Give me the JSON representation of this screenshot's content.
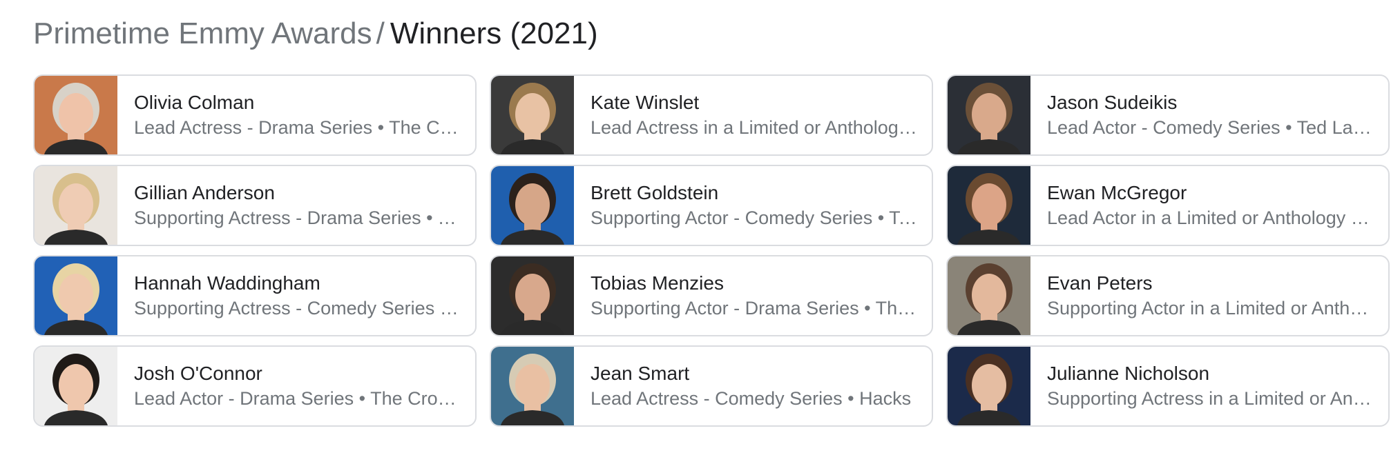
{
  "breadcrumb": {
    "parent": "Primetime Emmy Awards",
    "separator": "/",
    "current": "Winners (2021)"
  },
  "winners": [
    {
      "name": "Olivia Colman",
      "description": "Lead Actress - Drama Series • The Crown",
      "photo_bg": "#c9794a",
      "hair": "#d8d2c8",
      "skin": "#efc3a9"
    },
    {
      "name": "Kate Winslet",
      "description": "Lead Actress in a Limited or Anthology Series or Movie • Mare of Easttown",
      "photo_bg": "#3a3a3a",
      "hair": "#9b7a4e",
      "skin": "#e8c2a4"
    },
    {
      "name": "Jason Sudeikis",
      "description": "Lead Actor - Comedy Series • Ted Lasso",
      "photo_bg": "#2b2f36",
      "hair": "#6b5038",
      "skin": "#d9a98b"
    },
    {
      "name": "Gillian Anderson",
      "description": "Supporting Actress - Drama Series • The Crown",
      "photo_bg": "#e9e4de",
      "hair": "#d8bf8c",
      "skin": "#efccb4"
    },
    {
      "name": "Brett Goldstein",
      "description": "Supporting Actor - Comedy Series • Ted Lasso",
      "photo_bg": "#1f5fae",
      "hair": "#2b211b",
      "skin": "#d6a688"
    },
    {
      "name": "Ewan McGregor",
      "description": "Lead Actor in a Limited or Anthology Series or Movie • Halston",
      "photo_bg": "#1e2a3a",
      "hair": "#6a4a30",
      "skin": "#dca487"
    },
    {
      "name": "Hannah Waddingham",
      "description": "Supporting Actress - Comedy Series • Ted Lasso",
      "photo_bg": "#2161b6",
      "hair": "#e7d4a4",
      "skin": "#efc9ae"
    },
    {
      "name": "Tobias Menzies",
      "description": "Supporting Actor - Drama Series • The Crown",
      "photo_bg": "#2c2c2c",
      "hair": "#3b2c22",
      "skin": "#d8a88c"
    },
    {
      "name": "Evan Peters",
      "description": "Supporting Actor in a Limited or Anthology Series or Movie • Mare of Easttown",
      "photo_bg": "#8a8478",
      "hair": "#5a4030",
      "skin": "#e3b89c"
    },
    {
      "name": "Josh O'Connor",
      "description": "Lead Actor - Drama Series • The Crown",
      "photo_bg": "#eeeeee",
      "hair": "#1f1a17",
      "skin": "#efc7ad"
    },
    {
      "name": "Jean Smart",
      "description": "Lead Actress - Comedy Series • Hacks",
      "photo_bg": "#3f6f8e",
      "hair": "#d6cbb4",
      "skin": "#e9c0a3"
    },
    {
      "name": "Julianne Nicholson",
      "description": "Supporting Actress in a Limited or Anthology Series or Movie • Mare of Easttown",
      "photo_bg": "#1b2a4a",
      "hair": "#4a3022",
      "skin": "#e5bda2"
    }
  ]
}
